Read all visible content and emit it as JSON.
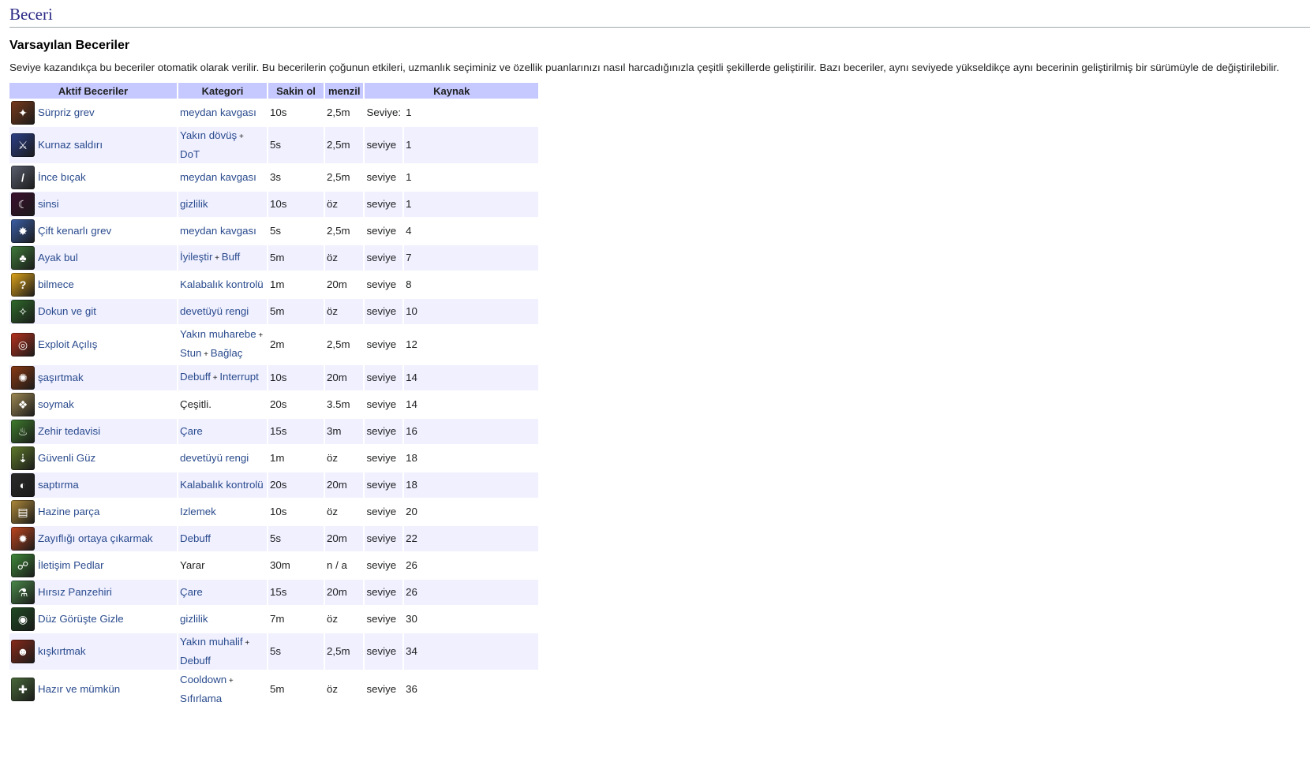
{
  "section_title": "Beceri",
  "subsection_title": "Varsayılan Beceriler",
  "intro_text": "Seviye kazandıkça bu beceriler otomatik olarak verilir. Bu becerilerin çoğunun etkileri, uzmanlık seçiminiz ve özellik puanlarınızı nasıl harcadığınızla çeşitli şekillerde geliştirilir. Bazı beceriler, aynı seviyede yükseldikçe aynı becerinin geliştirilmiş bir sürümüyle de değiştirilebilir.",
  "table": {
    "headers": {
      "skill": "Aktif Beceriler",
      "category": "Kategori",
      "cooldown": "Sakin ol",
      "range": "menzil",
      "source": "Kaynak"
    },
    "rows": [
      {
        "name": "Sürpriz grev",
        "icon": "surprise-strike-icon",
        "icon_color": "#7a3b1c",
        "glyph": "✦",
        "cat": [
          "meydan kavgası"
        ],
        "cat_plain": false,
        "cd": "10s",
        "range": "2,5m",
        "src_label": "Seviye:",
        "level": "1"
      },
      {
        "name": "Kurnaz saldırı",
        "icon": "cunning-attack-icon",
        "icon_color": "#2c3f8a",
        "glyph": "⚔",
        "cat": [
          "Yakın dövüş",
          "DoT"
        ],
        "cat_plain": false,
        "tall": true,
        "cd": "5s",
        "range": "2,5m",
        "src_label": "seviye",
        "level": "1"
      },
      {
        "name": "İnce bıçak",
        "icon": "fine-blade-icon",
        "icon_color": "#5a5f6e",
        "glyph": "/",
        "cat": [
          "meydan kavgası"
        ],
        "cat_plain": false,
        "cd": "3s",
        "range": "2,5m",
        "src_label": "seviye",
        "level": "1"
      },
      {
        "name": "sinsi",
        "icon": "sneak-icon",
        "icon_color": "#3b0f2e",
        "glyph": "☾",
        "cat": [
          "gizlilik"
        ],
        "cat_plain": false,
        "cd": "10s",
        "range": "öz",
        "src_label": "seviye",
        "level": "1"
      },
      {
        "name": "Çift kenarlı grev",
        "icon": "double-edged-strike-icon",
        "icon_color": "#3a5fa8",
        "glyph": "✸",
        "cat": [
          "meydan kavgası"
        ],
        "cat_plain": false,
        "cd": "5s",
        "range": "2,5m",
        "src_label": "seviye",
        "level": "4"
      },
      {
        "name": "Ayak bul",
        "icon": "find-footing-icon",
        "icon_color": "#3f7a3a",
        "glyph": "♣",
        "cat": [
          "İyileştir",
          "Buff"
        ],
        "cat_plain": false,
        "cd": "5m",
        "range": "öz",
        "src_label": "seviye",
        "level": "7"
      },
      {
        "name": "bilmece",
        "icon": "riddle-icon",
        "icon_color": "#e0a51a",
        "glyph": "?",
        "cat": [
          "Kalabalık kontrolü"
        ],
        "cat_plain": false,
        "cd": "1m",
        "range": "20m",
        "src_label": "seviye",
        "level": "8"
      },
      {
        "name": "Dokun ve git",
        "icon": "touch-and-go-icon",
        "icon_color": "#2f6b2a",
        "glyph": "✧",
        "cat": [
          "devetüyü rengi"
        ],
        "cat_plain": false,
        "cd": "5m",
        "range": "öz",
        "src_label": "seviye",
        "level": "10"
      },
      {
        "name": "Exploit Açılış",
        "icon": "exploit-opening-icon",
        "icon_color": "#b8321e",
        "glyph": "◎",
        "cat": [
          "Yakın muharebe",
          "Stun",
          "Bağlaç"
        ],
        "cat_plain": false,
        "tall": true,
        "cd": "2m",
        "range": "2,5m",
        "src_label": "seviye",
        "level": "12"
      },
      {
        "name": "şaşırtmak",
        "icon": "startle-icon",
        "icon_color": "#8a3a14",
        "glyph": "✺",
        "cat": [
          "Debuff",
          "Interrupt"
        ],
        "cat_plain": false,
        "cd": "10s",
        "range": "20m",
        "src_label": "seviye",
        "level": "14"
      },
      {
        "name": "soymak",
        "icon": "rob-icon",
        "icon_color": "#a08a55",
        "glyph": "❖",
        "cat": [
          "Çeşitli."
        ],
        "cat_plain": true,
        "cd": "20s",
        "range": "3.5m",
        "src_label": "seviye",
        "level": "14"
      },
      {
        "name": "Zehir tedavisi",
        "icon": "poison-cure-icon",
        "icon_color": "#3e7d2c",
        "glyph": "♨",
        "cat": [
          "Çare"
        ],
        "cat_plain": false,
        "cd": "15s",
        "range": "3m",
        "src_label": "seviye",
        "level": "16"
      },
      {
        "name": "Güvenli Güz",
        "icon": "safe-fall-icon",
        "icon_color": "#5f7a2a",
        "glyph": "⇣",
        "cat": [
          "devetüyü rengi"
        ],
        "cat_plain": false,
        "cd": "1m",
        "range": "öz",
        "src_label": "seviye",
        "level": "18"
      },
      {
        "name": "saptırma",
        "icon": "distraction-icon",
        "icon_color": "#2a2a2a",
        "glyph": "◐",
        "cat": [
          "Kalabalık kontrolü"
        ],
        "cat_plain": false,
        "cd": "20s",
        "range": "20m",
        "src_label": "seviye",
        "level": "18"
      },
      {
        "name": "Hazine parça",
        "icon": "treasure-piece-icon",
        "icon_color": "#b08a3a",
        "glyph": "▤",
        "cat": [
          "Izlemek"
        ],
        "cat_plain": false,
        "cd": "10s",
        "range": "öz",
        "src_label": "seviye",
        "level": "20"
      },
      {
        "name": "Zayıflığı ortaya çıkarmak",
        "icon": "reveal-weakness-icon",
        "icon_color": "#c0461f",
        "glyph": "✹",
        "cat": [
          "Debuff"
        ],
        "cat_plain": false,
        "cd": "5s",
        "range": "20m",
        "src_label": "seviye",
        "level": "22"
      },
      {
        "name": "İletişim Pedlar",
        "icon": "contact-pedlar-icon",
        "icon_color": "#3f8a3a",
        "glyph": "☍",
        "cat": [
          "Yarar"
        ],
        "cat_plain": true,
        "cd": "30m",
        "range": "n / a",
        "src_label": "seviye",
        "level": "26"
      },
      {
        "name": "Hırsız Panzehiri",
        "icon": "burglar-antidote-icon",
        "icon_color": "#4a8a4a",
        "glyph": "⚗",
        "cat": [
          "Çare"
        ],
        "cat_plain": false,
        "cd": "15s",
        "range": "20m",
        "src_label": "seviye",
        "level": "26"
      },
      {
        "name": "Düz Görüşte Gizle",
        "icon": "hide-in-plain-sight-icon",
        "icon_color": "#1f4a22",
        "glyph": "◉",
        "cat": [
          "gizlilik"
        ],
        "cat_plain": false,
        "cd": "7m",
        "range": "öz",
        "src_label": "seviye",
        "level": "30"
      },
      {
        "name": "kışkırtmak",
        "icon": "provoke-icon",
        "icon_color": "#8a2a1a",
        "glyph": "☻",
        "cat": [
          "Yakın muhalif",
          "Debuff"
        ],
        "cat_plain": false,
        "tall": true,
        "cd": "5s",
        "range": "2,5m",
        "src_label": "seviye",
        "level": "34"
      },
      {
        "name": "Hazır ve mümkün",
        "icon": "ready-and-able-icon",
        "icon_color": "#4a6a3a",
        "glyph": "✚",
        "cat": [
          "Cooldown",
          "Sıfırlama"
        ],
        "cat_plain": false,
        "tall": true,
        "cd": "5m",
        "range": "öz",
        "src_label": "seviye",
        "level": "36"
      }
    ]
  }
}
